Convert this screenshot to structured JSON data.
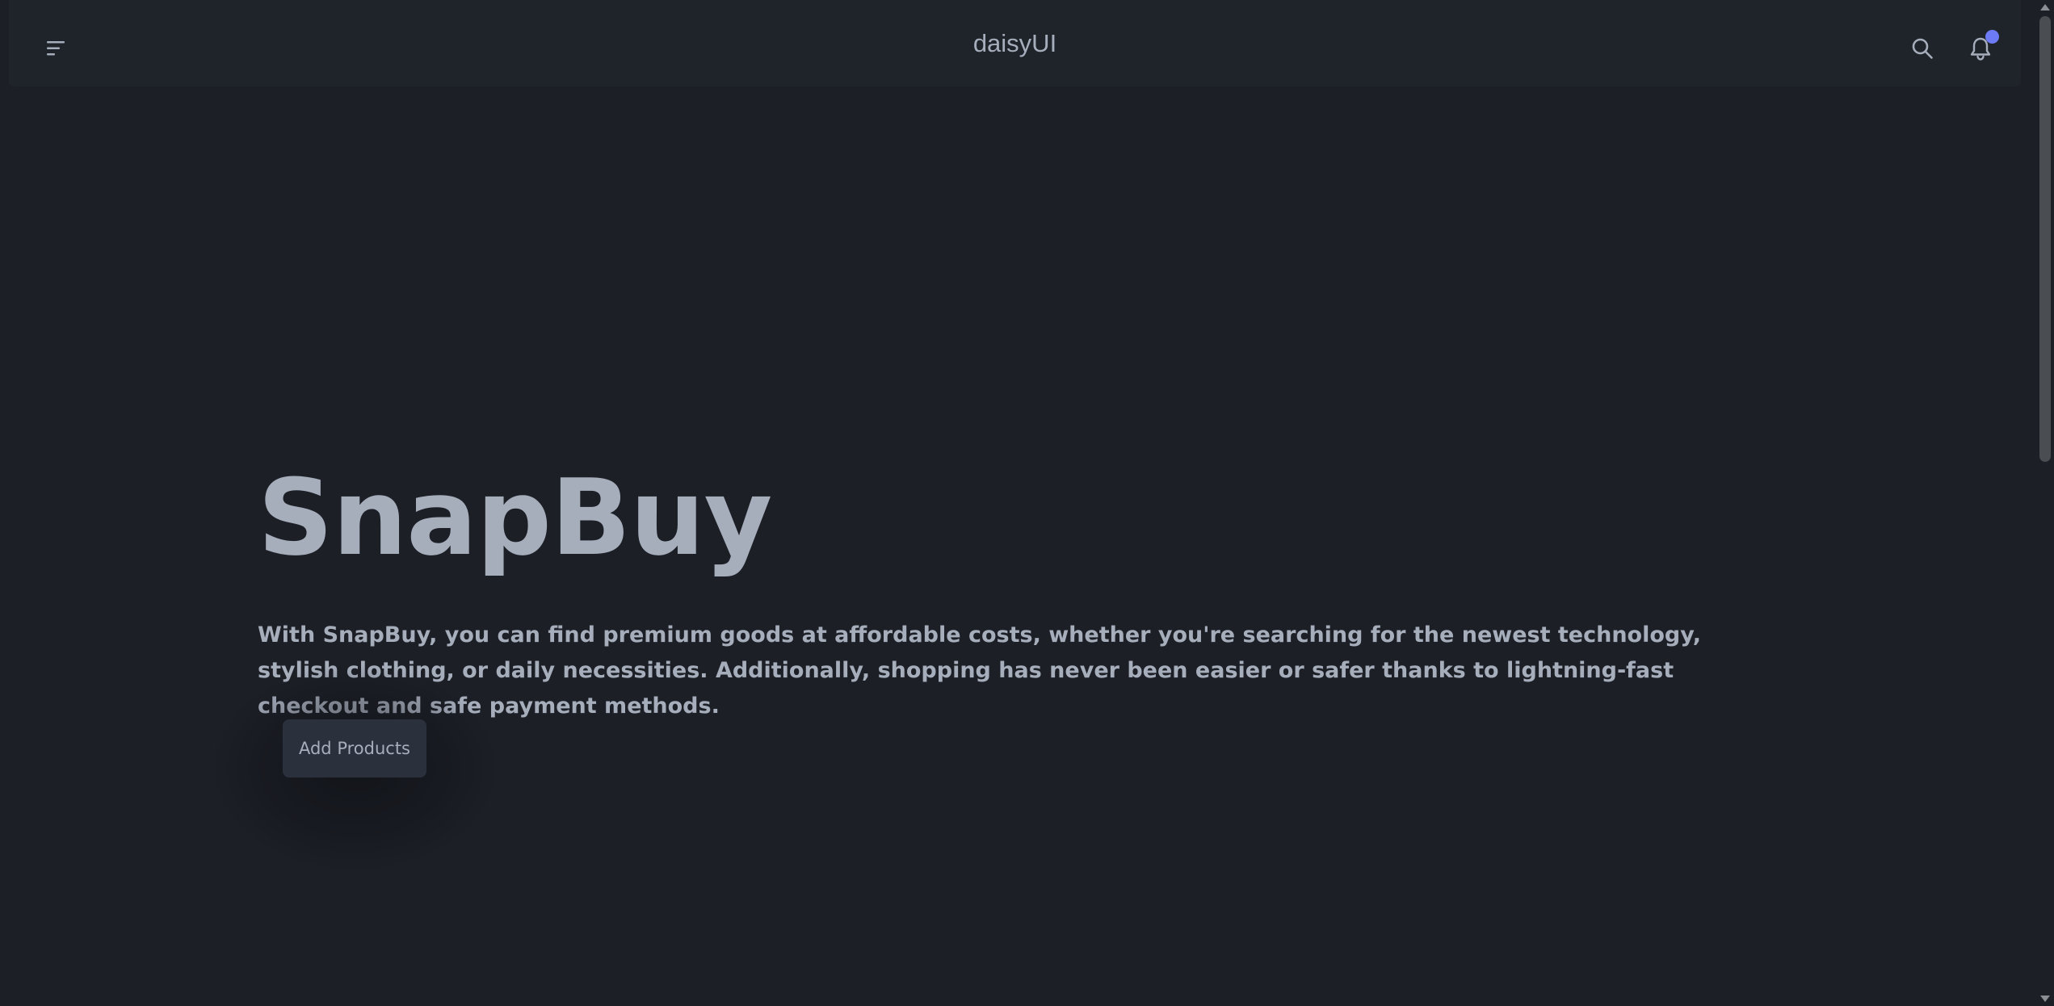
{
  "navbar": {
    "brand": "daisyUI",
    "menu_icon": "menu-icon",
    "search_icon": "search-icon",
    "bell_icon": "bell-icon",
    "badge_color": "#6d7cf6"
  },
  "hero": {
    "title": "SnapBuy",
    "description": "With SnapBuy, you can find premium goods at affordable costs, whether you're searching for the newest technology, stylish clothing, or daily necessities. Additionally, shopping has never been easier or safer thanks to lightning-fast checkout and safe payment methods.",
    "button_label": "Add Products"
  },
  "colors": {
    "background": "#1c1f26",
    "navbar": "#1f242b",
    "text": "#a6adbb",
    "button": "#2a303c",
    "accent": "#6d7cf6"
  }
}
